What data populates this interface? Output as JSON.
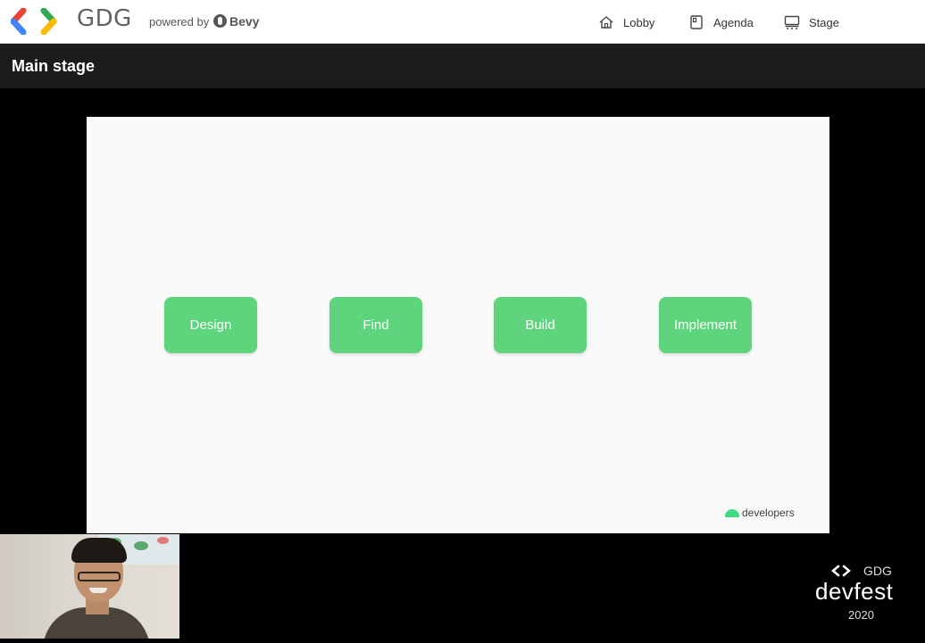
{
  "header": {
    "brand": "GDG",
    "powered_by": "powered by",
    "partner": "Bevy",
    "nav": [
      {
        "label": "Lobby",
        "icon": "home-icon"
      },
      {
        "label": "Agenda",
        "icon": "agenda-icon"
      },
      {
        "label": "Stage",
        "icon": "stage-icon"
      }
    ]
  },
  "stage": {
    "title": "Main stage"
  },
  "slide": {
    "steps": [
      "Design",
      "Find",
      "Build",
      "Implement"
    ],
    "footer_logo": "developers",
    "step_color": "#5ed47c"
  },
  "branding": {
    "gdg": "GDG",
    "event": "devfest",
    "year": "2020"
  }
}
